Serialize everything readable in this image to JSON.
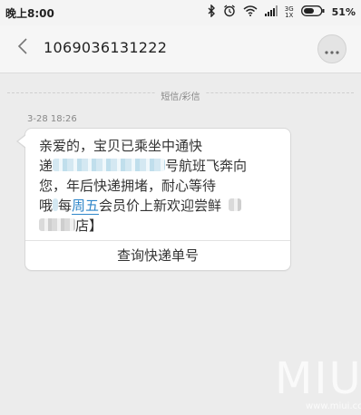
{
  "status_bar": {
    "time": "晚上8:00",
    "network_top": "3G",
    "network_bottom": "1X",
    "battery_percent": "51%"
  },
  "header": {
    "title": "1069036131222"
  },
  "divider": {
    "label": "短信/彩信"
  },
  "message": {
    "timestamp": "3-28  18:26",
    "line1": "亲爱的，宝贝已乘坐中通快",
    "line2_prefix": "递",
    "line2_suffix": "号航班飞奔向",
    "line3": "您，年后快递拥堵，耐心等待",
    "line4_prefix": "哦",
    "line4_mid": "每",
    "line4_link": "周五",
    "line4_suffix": "会员价上新欢迎尝鲜",
    "line5_suffix": "店】",
    "action_label": "查询快递单号"
  },
  "watermark": {
    "logo": "MIUI",
    "url": "www.miui.com"
  }
}
